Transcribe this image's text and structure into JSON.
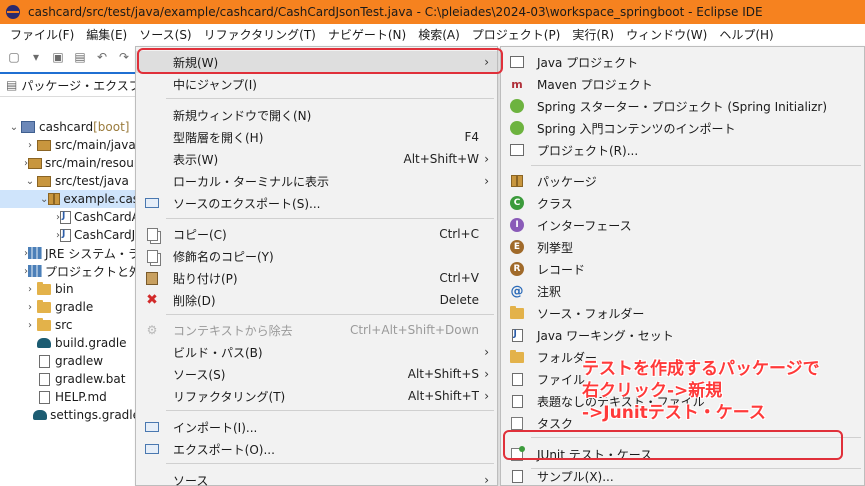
{
  "window": {
    "title": "cashcard/src/test/java/example/cashcard/CashCardJsonTest.java - C:\\pleiades\\2024-03\\workspace_springboot - Eclipse IDE"
  },
  "menubar": [
    "ファイル(F)",
    "編集(E)",
    "ソース(S)",
    "リファクタリング(T)",
    "ナビゲート(N)",
    "検索(A)",
    "プロジェクト(P)",
    "実行(R)",
    "ウィンドウ(W)",
    "ヘルプ(H)"
  ],
  "explorer": {
    "tab_label": "パッケージ・エクスプローラー",
    "tree": [
      {
        "label": "cashcard",
        "suffix": " [boot]",
        "level": 0,
        "expanded": true,
        "icon": "project-icon"
      },
      {
        "label": "src/main/java",
        "level": 1,
        "expanded": false,
        "icon": "source-folder-icon"
      },
      {
        "label": "src/main/resources",
        "level": 1,
        "expanded": false,
        "icon": "source-folder-icon"
      },
      {
        "label": "src/test/java",
        "level": 1,
        "expanded": true,
        "icon": "source-folder-icon"
      },
      {
        "label": "example.cashcard",
        "level": 2,
        "expanded": true,
        "icon": "package-icon",
        "selected": true
      },
      {
        "label": "CashCardApplicationTests.java",
        "level": 3,
        "expanded": false,
        "icon": "java-file-icon"
      },
      {
        "label": "CashCardJsonTest.java",
        "level": 3,
        "expanded": false,
        "icon": "java-file-icon"
      },
      {
        "label": "JRE システム・ライブラリー",
        "level": 1,
        "expanded": false,
        "icon": "library-icon"
      },
      {
        "label": "プロジェクトと外部の依存関係",
        "level": 1,
        "expanded": false,
        "icon": "library-icon"
      },
      {
        "label": "bin",
        "level": 1,
        "expanded": false,
        "icon": "folder-icon"
      },
      {
        "label": "gradle",
        "level": 1,
        "expanded": false,
        "icon": "folder-icon"
      },
      {
        "label": "src",
        "level": 1,
        "expanded": false,
        "icon": "folder-icon"
      },
      {
        "label": "build.gradle",
        "level": 1,
        "leaf": true,
        "icon": "gradle-file-icon"
      },
      {
        "label": "gradlew",
        "level": 1,
        "leaf": true,
        "icon": "file-icon"
      },
      {
        "label": "gradlew.bat",
        "level": 1,
        "leaf": true,
        "icon": "file-icon"
      },
      {
        "label": "HELP.md",
        "level": 1,
        "leaf": true,
        "icon": "markdown-file-icon"
      },
      {
        "label": "settings.gradle",
        "level": 1,
        "leaf": true,
        "icon": "gradle-file-icon"
      }
    ]
  },
  "context_menu": {
    "new": "新規(W)",
    "go_into": "中にジャンプ(I)",
    "open_new_window": "新規ウィンドウで開く(N)",
    "open_type_hierarchy": "型階層を開く(H)",
    "open_type_hierarchy_sc": "F4",
    "show_in": "表示(W)",
    "show_in_sc": "Alt+Shift+W",
    "show_in_terminal": "ローカル・ターミナルに表示",
    "export_source": "ソースのエクスポート(S)...",
    "copy": "コピー(C)",
    "copy_sc": "Ctrl+C",
    "copy_qualified": "修飾名のコピー(Y)",
    "paste": "貼り付け(P)",
    "paste_sc": "Ctrl+V",
    "delete": "削除(D)",
    "delete_sc": "Delete",
    "remove_context": "コンテキストから除去",
    "remove_context_sc": "Ctrl+Alt+Shift+Down",
    "build_path": "ビルド・パス(B)",
    "source": "ソース(S)",
    "source_sc": "Alt+Shift+S",
    "refactor": "リファクタリング(T)",
    "refactor_sc": "Alt+Shift+T",
    "import": "インポート(I)...",
    "export": "エクスポート(O)...",
    "source_bottom": "ソース"
  },
  "new_submenu": {
    "java_project": "Java プロジェクト",
    "maven_project": "Maven プロジェクト",
    "spring_starter": "Spring スターター・プロジェクト (Spring Initializr)",
    "spring_guides": "Spring 入門コンテンツのインポート",
    "project": "プロジェクト(R)...",
    "package": "パッケージ",
    "class": "クラス",
    "interface": "インターフェース",
    "enum": "列挙型",
    "record": "レコード",
    "annotation": "注釈",
    "source_folder": "ソース・フォルダー",
    "java_working_set": "Java ワーキング・セット",
    "folder": "フォルダー",
    "file": "ファイル",
    "untitled_text_file": "表題なしのテキスト・ファイル",
    "task": "タスク",
    "junit_test_case": "JUnit テスト・ケース",
    "example": "サンプル(X)..."
  },
  "annotation": {
    "line1": "テストを作成するパッケージで",
    "line2": "右クリック->新規",
    "line3": "->Junitテスト・ケース"
  },
  "colors": {
    "titlebar": "#f6821f",
    "highlight_box": "#e0303a",
    "annotation_text": "#ff3a3a",
    "selection": "#cfe4fb"
  }
}
